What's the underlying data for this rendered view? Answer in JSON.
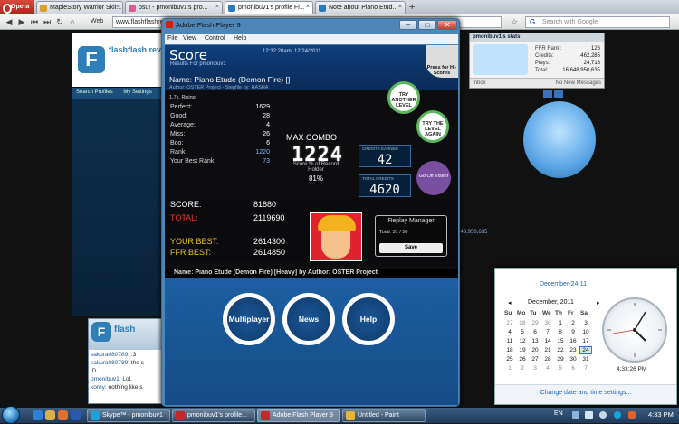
{
  "browser": {
    "brand": "Opera",
    "tabs": [
      {
        "label": "MapleStory Warrior Skil...",
        "color": "#d8a02a"
      },
      {
        "label": "osu! - pmonibuv1's pro...",
        "color": "#e05a9a"
      },
      {
        "label": "pmonibuv1's profile Fl...",
        "color": "#2a7ac0"
      },
      {
        "label": "Note about Piano Etud...",
        "color": "#2a7ac0"
      }
    ],
    "new_tab": "+",
    "web_label": "Web",
    "url": "www.flashflashrevolution.com",
    "search_placeholder": "Search with Google"
  },
  "site": {
    "logo_text": "flashflash rev",
    "nav": [
      "Search Profiles",
      "My Settings"
    ],
    "user_stats": {
      "header": "pmonibuv1's stats:",
      "rows": [
        {
          "label": "FFR Rank:",
          "value": "126"
        },
        {
          "label": "Credits:",
          "value": "462,285"
        },
        {
          "label": "Plays:",
          "value": "24,713"
        },
        {
          "label": "Total:",
          "value": "16,648,950,635"
        }
      ],
      "bar_left": "Inbox",
      "bar_right": "No New Messages"
    },
    "side_value": "648,950,635",
    "chat": [
      {
        "user": "sakura080789:",
        "text": ":3"
      },
      {
        "user": "sakura080789:",
        "text": "the s"
      },
      {
        "user": "",
        "text": ";D"
      },
      {
        "user": "pmonibuv1:",
        "text": "Lol."
      },
      {
        "user": "korny:",
        "text": "nothing like s"
      }
    ]
  },
  "flash": {
    "title": "Adobe Flash Player 9",
    "menu": [
      "File",
      "View",
      "Control",
      "Help"
    ],
    "game": {
      "score_title": "Score",
      "results_for": "Results For pmonibuv1",
      "date": "12:32:28am, 12/24/2011",
      "hiscore_btn": "Press for Hi-Scores",
      "song": "Name: Piano Etude (Demon Fire) []",
      "author": "Author: OSTER Project  -  Stepfile by: HASHA",
      "rate_line": "1.7x, Rising",
      "stats": [
        {
          "label": "Perfect:",
          "value": "1629"
        },
        {
          "label": "Good:",
          "value": "28"
        },
        {
          "label": "Average:",
          "value": "4"
        },
        {
          "label": "Miss:",
          "value": "26"
        },
        {
          "label": "Boo:",
          "value": "6"
        },
        {
          "label": "Rank:",
          "value": "1220"
        },
        {
          "label": "Your Best Rank:",
          "value": "73"
        }
      ],
      "try_another": "TRY ANOTHER LEVEL",
      "try_again": "TRY THE LEVEL AGAIN",
      "max_combo_label": "MAX COMBO",
      "max_combo": "1224",
      "pct_label": "Score % of Record Holder",
      "pct_value": "81%",
      "credits_earned_label": "CREDITS EARNED",
      "credits_earned": "42",
      "total_credits_label": "TOTAL CREDITS",
      "total_credits": "4620",
      "visit_label": "Go Off Visitor",
      "score_label": "SCORE:",
      "score_value": "81880",
      "total_label": "TOTAL:",
      "total_value": "2119690",
      "your_best_label": "YOUR BEST:",
      "your_best_value": "2614300",
      "ffr_best_label": "FFR BEST:",
      "ffr_best_value": "2614850",
      "replay_title": "Replay Manager",
      "replay_total": "Total: 31 / 50",
      "replay_save": "Save",
      "scroller": "Name: Piano Etude (Demon Fire) [Heavy] by Author: OSTER Project",
      "buttons": [
        "Multiplayer",
        "News",
        "Help"
      ]
    }
  },
  "calendar": {
    "title": "December-24-11",
    "month": "December, 2011",
    "dow": [
      "Su",
      "Mo",
      "Tu",
      "We",
      "Th",
      "Fr",
      "Sa"
    ],
    "weeks": [
      [
        "27",
        "28",
        "29",
        "30",
        "1",
        "2",
        "3"
      ],
      [
        "4",
        "5",
        "6",
        "7",
        "8",
        "9",
        "10"
      ],
      [
        "11",
        "12",
        "13",
        "14",
        "15",
        "16",
        "17"
      ],
      [
        "18",
        "19",
        "20",
        "21",
        "22",
        "23",
        "24"
      ],
      [
        "25",
        "26",
        "27",
        "28",
        "29",
        "30",
        "31"
      ],
      [
        "1",
        "2",
        "3",
        "4",
        "5",
        "6",
        "7"
      ]
    ],
    "clock_time": "4:33:26 PM",
    "link": "Change date and time settings..."
  },
  "taskbar": {
    "items": [
      {
        "label": "Skype™ - pmonibuv1",
        "color": "#19a3e0"
      },
      {
        "label": "pmonibuv1's profile...",
        "color": "#c8262a"
      },
      {
        "label": "Adobe Flash Player 9",
        "color": "#c8262a"
      },
      {
        "label": "Untitled - Paint",
        "color": "#e6b43a"
      }
    ],
    "lang": "EN",
    "time": "4:33 PM"
  }
}
